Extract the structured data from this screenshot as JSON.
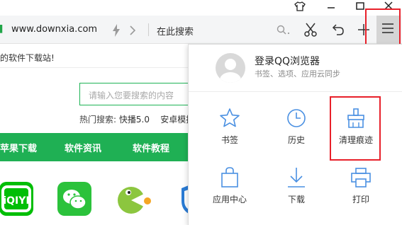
{
  "window": {
    "controls": [
      {
        "icon": "shirt-icon"
      },
      {
        "icon": "minimize-icon"
      },
      {
        "icon": "maximize-icon"
      },
      {
        "icon": "close-icon"
      }
    ]
  },
  "toolbar": {
    "url": "www.downxia.com",
    "search_text": "在此搜索",
    "icons": [
      "lightning-icon",
      "chevron-right-icon",
      "search-icon",
      "scissors-icon",
      "undo-icon",
      "plus-icon",
      "menu-icon"
    ]
  },
  "page": {
    "welcome": "的软件下载站!",
    "search_placeholder": "请输入您要搜索的内容",
    "hot_label": "热门搜索:",
    "hot_items": [
      "快播5.0",
      "安卓模拟"
    ],
    "nav": [
      "苹果下载",
      "软件资讯",
      "软件教程"
    ],
    "nav_color": "#1fb054",
    "apps": [
      "iqiyi-app-icon",
      "wechat-app-icon",
      "pacman-app-icon",
      "shield-app-icon"
    ]
  },
  "menu": {
    "login_title": "登录QQ浏览器",
    "login_subtitle": "书签、选项、应用云同步",
    "items": [
      {
        "label": "书签",
        "icon": "star-icon"
      },
      {
        "label": "历史",
        "icon": "clock-icon"
      },
      {
        "label": "清理痕迹",
        "icon": "broom-icon"
      },
      {
        "label": "应用中心",
        "icon": "bag-icon"
      },
      {
        "label": "下载",
        "icon": "download-icon"
      },
      {
        "label": "打印",
        "icon": "printer-icon"
      }
    ],
    "accent": "#4a90e2",
    "highlight_color": "#e8202a"
  }
}
